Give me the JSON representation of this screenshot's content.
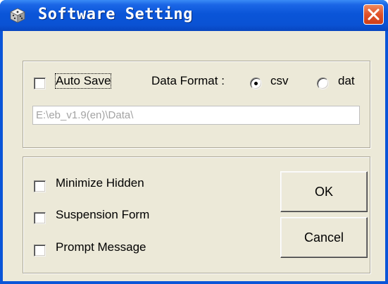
{
  "window": {
    "title": "Software Setting",
    "app_icon": "dice-icon",
    "close_icon": "close-icon"
  },
  "storage_group": {
    "auto_save": {
      "label": "Auto Save",
      "checked": false
    },
    "data_format_label": "Data Format :",
    "formats": [
      {
        "label": "csv",
        "selected": true
      },
      {
        "label": "dat",
        "selected": false
      }
    ],
    "path_value": "E:\\eb_v1.9(en)\\Data\\"
  },
  "options_group": {
    "options": [
      {
        "label": "Minimize Hidden",
        "checked": false
      },
      {
        "label": "Suspension Form",
        "checked": false
      },
      {
        "label": "Prompt Message",
        "checked": false
      }
    ],
    "ok_label": "OK",
    "cancel_label": "Cancel"
  },
  "colors": {
    "titlebar": "#0a55d8",
    "close_button": "#e0522a",
    "client_bg": "#ece9d8"
  }
}
